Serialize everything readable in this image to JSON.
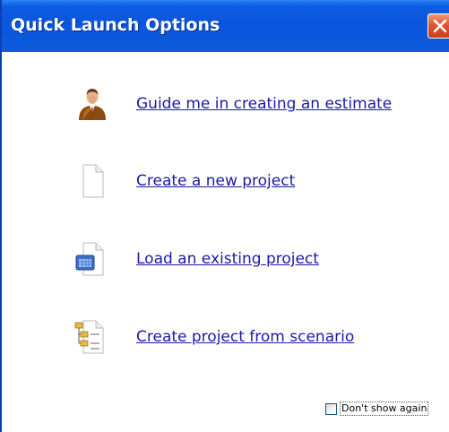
{
  "window": {
    "title": "Quick Launch Options"
  },
  "options": [
    {
      "label": "Guide me in creating an estimate",
      "icon": "person-icon"
    },
    {
      "label": "Create a new project",
      "icon": "blank-document-icon"
    },
    {
      "label": "Load an existing project",
      "icon": "open-document-icon"
    },
    {
      "label": "Create project from scenario",
      "icon": "scenario-document-icon"
    }
  ],
  "footer": {
    "dont_show_label": "Don't show again",
    "dont_show_checked": false
  },
  "colors": {
    "titlebar": "#0a55dc",
    "link": "#1a1aa6",
    "close": "#e0552f"
  }
}
